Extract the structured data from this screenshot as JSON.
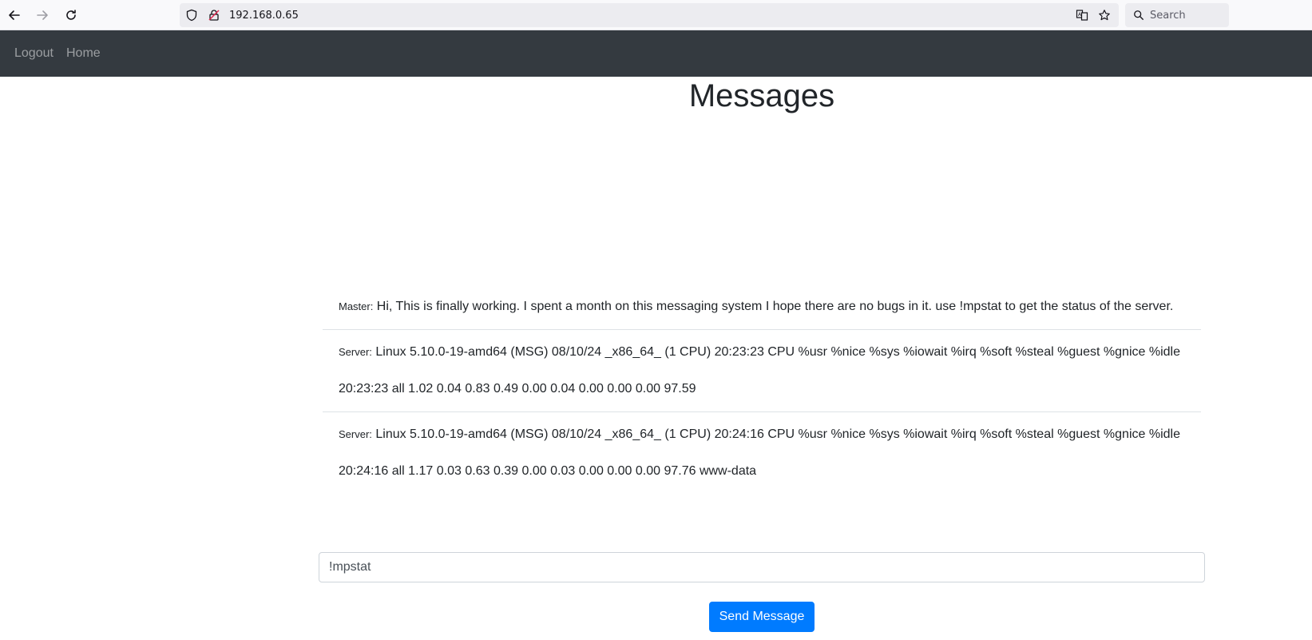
{
  "browser": {
    "url": "192.168.0.65",
    "search_placeholder": "Search"
  },
  "navbar": {
    "links": [
      {
        "label": "Logout"
      },
      {
        "label": "Home"
      }
    ]
  },
  "page": {
    "title": "Messages"
  },
  "messages": [
    {
      "sender": "Master:",
      "lines": [
        "Hi, This is finally working. I spent a month on this messaging system I hope there are no bugs in it. use !mpstat to get the status of the server."
      ]
    },
    {
      "sender": "Server:",
      "lines": [
        "Linux 5.10.0-19-amd64 (MSG) 08/10/24 _x86_64_ (1 CPU) 20:23:23 CPU %usr %nice %sys %iowait %irq %soft %steal %guest %gnice %idle",
        "20:23:23 all 1.02 0.04 0.83 0.49 0.00 0.04 0.00 0.00 0.00 97.59"
      ]
    },
    {
      "sender": "Server:",
      "lines": [
        "Linux 5.10.0-19-amd64 (MSG) 08/10/24 _x86_64_ (1 CPU) 20:24:16 CPU %usr %nice %sys %iowait %irq %soft %steal %guest %gnice %idle",
        "20:24:16 all 1.17 0.03 0.63 0.39 0.00 0.03 0.00 0.00 0.00 97.76 www-data"
      ]
    }
  ],
  "composer": {
    "input_value": "!mpstat",
    "send_label": "Send Message"
  },
  "colors": {
    "navbar_bg": "#343a40",
    "primary": "#007bff"
  }
}
